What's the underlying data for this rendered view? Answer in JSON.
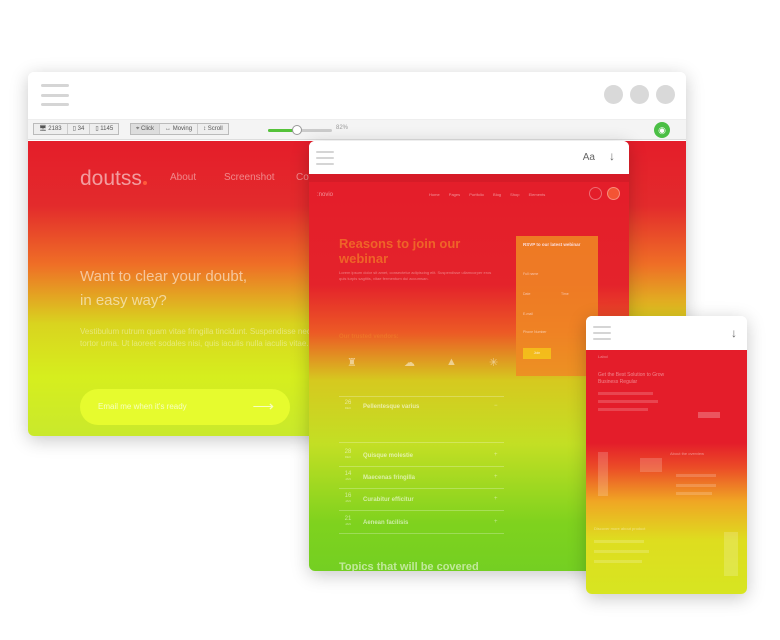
{
  "desktop": {
    "toolbar": {
      "counts": [
        "2183",
        "34",
        "1145"
      ],
      "modes": [
        "Click",
        "Moving",
        "Scroll"
      ],
      "zoom": "82%",
      "slider_level": 0.45
    },
    "site": {
      "logo": "doutss",
      "nav": [
        "About",
        "Screenshot",
        "Co"
      ],
      "headline": [
        "Want to clear your doubt,",
        "in easy way?"
      ],
      "body": "Vestibulum rutrum quam vitae fringilla tincidunt. Suspendisse nec tortor urna. Ut laoreet sodales nisi, quis iaculis nulla iaculis vitae.",
      "cta": "Email me when it's ready",
      "cta_arrow": "⟶"
    }
  },
  "tablet": {
    "aa": "Aa",
    "down": "↓",
    "logo": ":novio",
    "nav": "Home Pages Portfolio Blog Shop Elements",
    "headline": [
      "Reasons to join our",
      "webinar"
    ],
    "body": "Lorem ipsum dolor sit amet, consectetur adipiscing elit. Suspendisse ullamcorper eros quis turpis sagittis, vitae fermentum dui accumsan.",
    "vendors_label": "Our trusted vendors:",
    "form": {
      "title": "RSVP to our latest webinar",
      "fields": [
        "Full name",
        "Date",
        "Time",
        "E-mail",
        "Phone Number"
      ],
      "button": "Join"
    },
    "agenda": [
      {
        "day": "26",
        "month": "DEC",
        "title": "Pellentesque varius"
      },
      {
        "day": "28",
        "month": "DEC",
        "title": "Quisque molestie"
      },
      {
        "day": "14",
        "month": "JAN",
        "title": "Maecenas fringilla"
      },
      {
        "day": "16",
        "month": "JAN",
        "title": "Curabitur efficitur"
      },
      {
        "day": "21",
        "month": "JAN",
        "title": "Aenean facilisis"
      }
    ],
    "topics": "Topics that will be covered"
  },
  "phone": {
    "logo": "Labol",
    "headline": "Get the Best Solution to Grow Business Regular",
    "section": "About the overview",
    "footer": "Discover more about product"
  }
}
